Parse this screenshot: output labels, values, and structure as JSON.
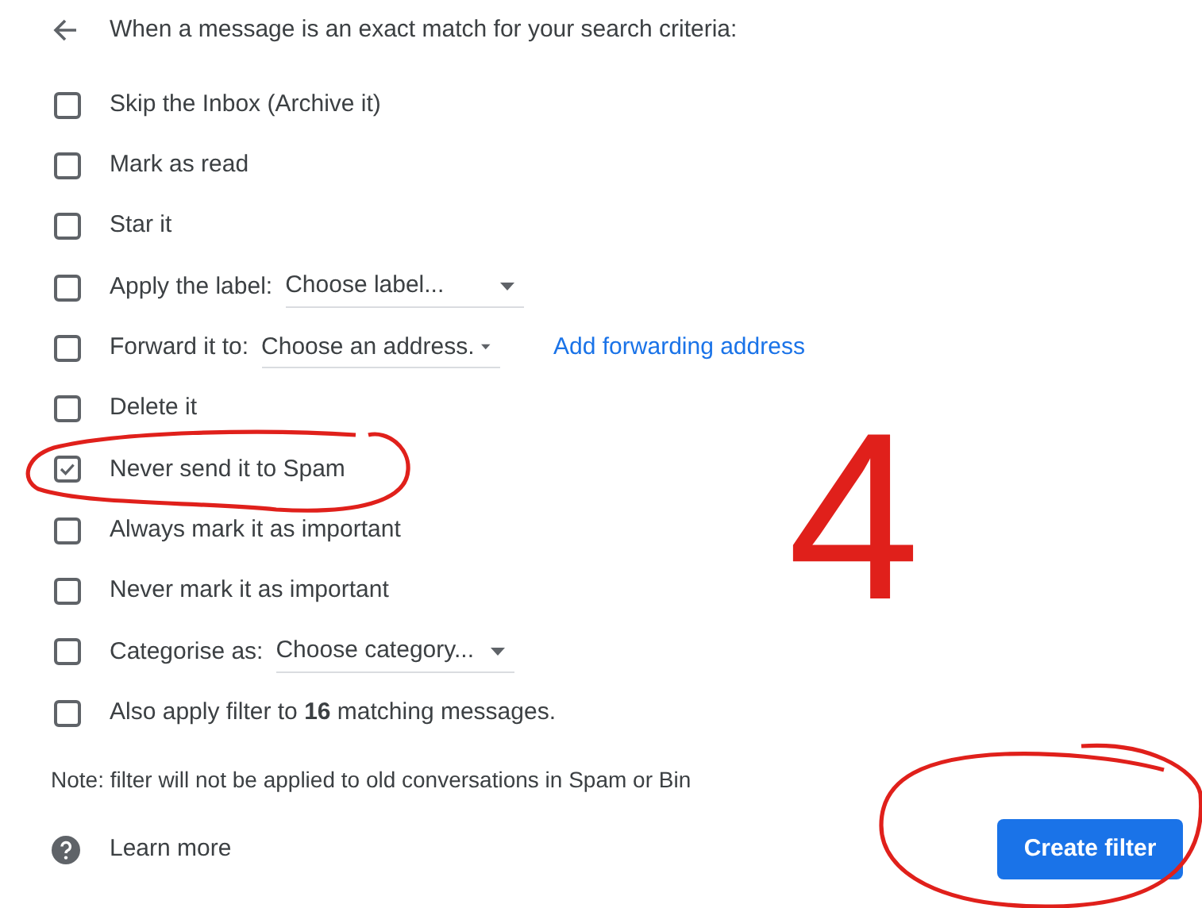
{
  "header": {
    "title": "When a message is an exact match for your search criteria:"
  },
  "options": [
    {
      "label": "Skip the Inbox (Archive it)",
      "checked": false
    },
    {
      "label": "Mark as read",
      "checked": false
    },
    {
      "label": "Star it",
      "checked": false
    },
    {
      "label": "Apply the label:",
      "checked": false,
      "select": "Choose label..."
    },
    {
      "label": "Forward it to:",
      "checked": false,
      "select": "Choose an address.",
      "link": "Add forwarding address"
    },
    {
      "label": "Delete it",
      "checked": false
    },
    {
      "label": "Never send it to Spam",
      "checked": true
    },
    {
      "label": "Always mark it as important",
      "checked": false
    },
    {
      "label": "Never mark it as important",
      "checked": false
    },
    {
      "label": "Categorise as:",
      "checked": false,
      "select": "Choose category..."
    },
    {
      "label": "Also apply filter to **16** matching messages.",
      "checked": false
    }
  ],
  "note": "Note: filter will not be applied to old conversations in Spam or Bin",
  "learn_more": "Learn more",
  "create_button": "Create filter",
  "annotation": {
    "label": "4"
  }
}
